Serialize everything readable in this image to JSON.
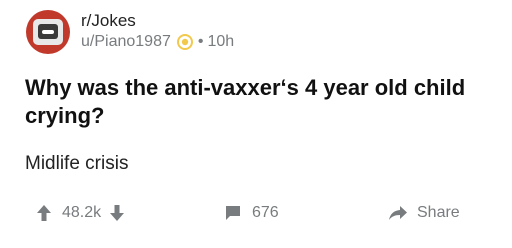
{
  "post": {
    "subreddit": "r/Jokes",
    "username": "u/Piano1987",
    "separator": "•",
    "time_ago": "10h",
    "title": "Why was the anti-vaxxer‘s 4 year old child crying?",
    "body": "Midlife crisis"
  },
  "actions": {
    "score": "48.2k",
    "comments": "676",
    "share_label": "Share"
  },
  "icons": {
    "avatar": "subreddit-avatar",
    "award": "award-icon",
    "upvote": "upvote-icon",
    "downvote": "downvote-icon",
    "comment": "comment-icon",
    "share": "share-icon"
  },
  "colors": {
    "award": "#f2c94c",
    "icon_gray": "#787c7e",
    "avatar_red": "#c0392b"
  }
}
